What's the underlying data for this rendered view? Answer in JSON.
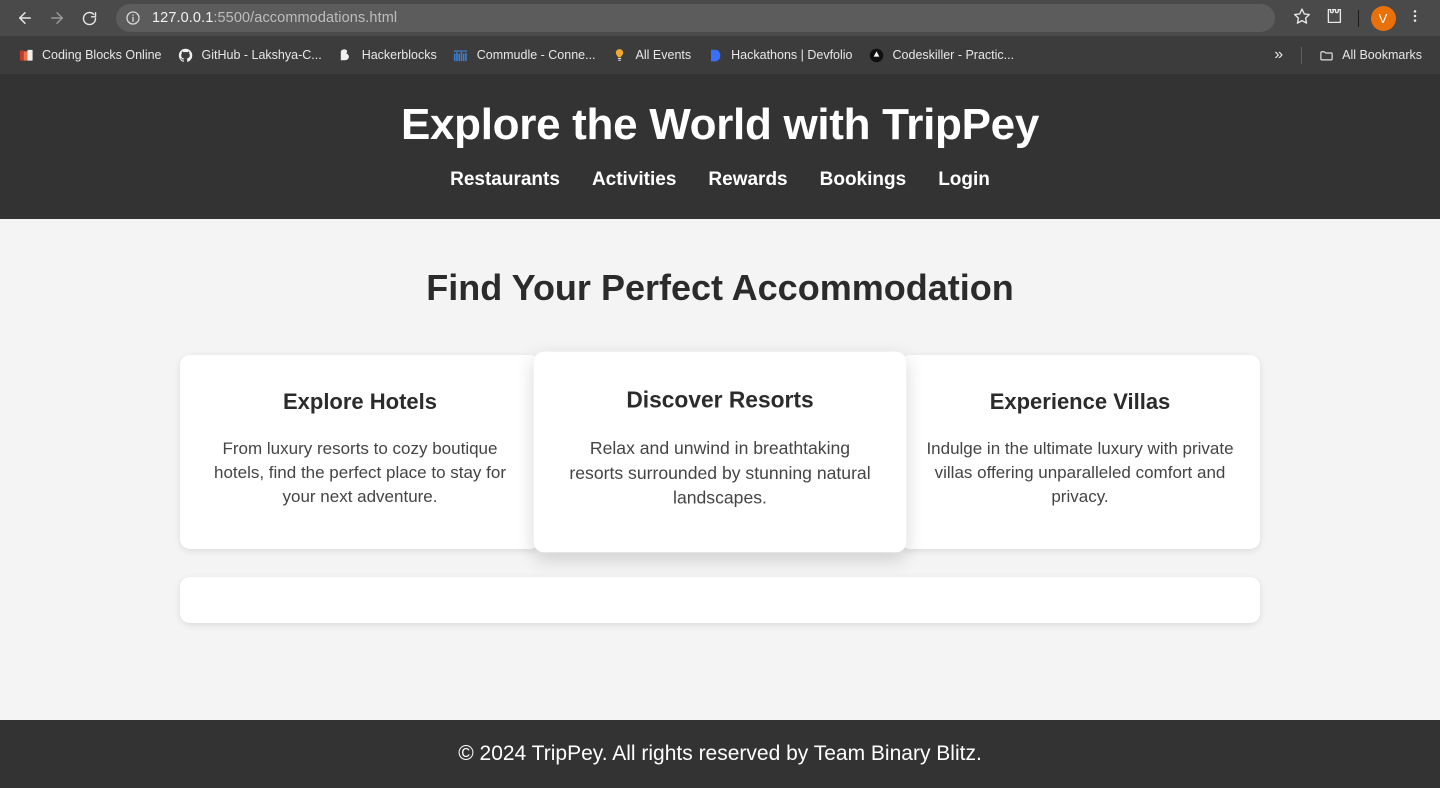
{
  "browser": {
    "back_icon": "back-arrow-icon",
    "forward_icon": "forward-arrow-icon",
    "reload_icon": "reload-icon",
    "site_info_icon": "site-info-icon",
    "url_host": "127.0.0.1",
    "url_rest": ":5500/accommodations.html",
    "url_full": "127.0.0.1:5500/accommodations.html",
    "bookmark_star_icon": "star-icon",
    "extensions_icon": "extensions-puzzle-icon",
    "menu_icon": "three-dot-menu-icon",
    "avatar_initial": "V",
    "avatar_color": "#e8710a",
    "toolbar_bg": "#4a4a4a",
    "bookmarks_bg": "#3c3c3c"
  },
  "bookmarks": {
    "items": [
      {
        "label": "Coding Blocks Online",
        "icon": "coding-blocks-icon"
      },
      {
        "label": "GitHub - Lakshya-C...",
        "icon": "github-icon"
      },
      {
        "label": "Hackerblocks",
        "icon": "hackerblocks-icon"
      },
      {
        "label": "Commudle - Conne...",
        "icon": "commudle-icon"
      },
      {
        "label": "All Events",
        "icon": "all-events-icon"
      },
      {
        "label": "Hackathons | Devfolio",
        "icon": "devfolio-icon"
      },
      {
        "label": "Codeskiller - Practic...",
        "icon": "codeskiller-icon"
      }
    ],
    "overflow_label": "»",
    "all_bookmarks_label": "All Bookmarks",
    "all_bookmarks_icon": "folder-icon"
  },
  "header": {
    "title": "Explore the World with TripPey",
    "bg_color": "#333333",
    "nav": [
      {
        "label": "Restaurants"
      },
      {
        "label": "Activities"
      },
      {
        "label": "Rewards"
      },
      {
        "label": "Bookings"
      },
      {
        "label": "Login"
      }
    ]
  },
  "main": {
    "section_title": "Find Your Perfect Accommodation",
    "cards": [
      {
        "title": "Explore Hotels",
        "text": "From luxury resorts to cozy boutique hotels, find the perfect place to stay for your next adventure.",
        "hovered": false
      },
      {
        "title": "Discover Resorts",
        "text": "Relax and unwind in breathtaking resorts surrounded by stunning natural landscapes.",
        "hovered": true
      },
      {
        "title": "Experience Villas",
        "text": "Indulge in the ultimate luxury with private villas offering unparalleled comfort and privacy.",
        "hovered": false
      }
    ],
    "empty_panel": ""
  },
  "footer": {
    "text": "© 2024 TripPey. All rights reserved by Team Binary Blitz."
  }
}
